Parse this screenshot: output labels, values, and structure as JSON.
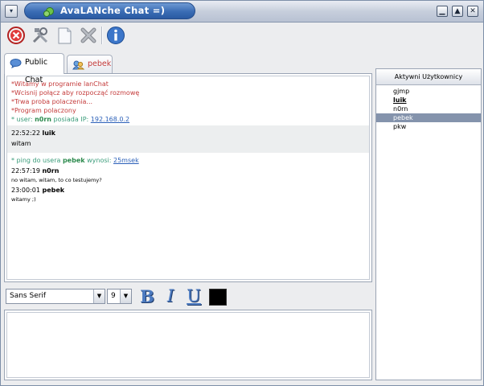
{
  "window": {
    "title": "AvaLANche Chat =)",
    "sysmenu_glyph": "▾",
    "minimize_glyph": "▁",
    "maximize_glyph": "▲",
    "close_glyph": "✕",
    "icon": "app-network-icon"
  },
  "toolbar": {
    "items": [
      {
        "name": "disconnect-icon"
      },
      {
        "name": "settings-tools-icon"
      },
      {
        "name": "clear-page-icon"
      },
      {
        "name": "close-tab-icon"
      },
      {
        "name": "info-icon"
      }
    ]
  },
  "tabs": [
    {
      "label": "Public Chat",
      "active": true,
      "icon": "chat-bubble-icon"
    },
    {
      "label": "pebek",
      "active": false,
      "icon": "user-icon"
    }
  ],
  "chat": {
    "system_lines": [
      "*Witamy w programie lanChat",
      "*Wcisnij połącz aby rozpocząć rozmowę",
      "*Trwa proba polaczenia...",
      "*Program polaczony"
    ],
    "info1": {
      "prefix": "* user: ",
      "user": "n0rn",
      "middle": " posiada IP: ",
      "link": "192.168.0.2"
    },
    "msg1": {
      "time": "22:52:22",
      "user": "luik",
      "text": "witam"
    },
    "info2": {
      "prefix": "* ping do usera ",
      "user": "pebek",
      "middle": " wynosi: ",
      "link": "25msek"
    },
    "msg2": {
      "time": "22:57:19",
      "user": "n0rn",
      "text": "no witam, witam, to co testujemy?"
    },
    "msg3": {
      "time": "23:00:01",
      "user": "pebek",
      "text": "witamy ;)"
    }
  },
  "format": {
    "font_family": "Sans Serif",
    "font_size": "9",
    "bold_label": "B",
    "italic_label": "I",
    "underline_label": "U",
    "arrow_glyph": "▼",
    "color": "#000000"
  },
  "input": {
    "value": ""
  },
  "users": {
    "header": "Aktywni Użytkownicy",
    "list": [
      {
        "name": "gjmp",
        "selected": false,
        "bold": false
      },
      {
        "name": "luik",
        "selected": false,
        "bold": true
      },
      {
        "name": "n0rn",
        "selected": false,
        "bold": false
      },
      {
        "name": "pebek",
        "selected": true,
        "bold": false
      },
      {
        "name": "pkw",
        "selected": false,
        "bold": false
      }
    ]
  },
  "colors": {
    "system_text": "#c43b3b",
    "info_text": "#3a9c7a",
    "title_bar": "#3a6cb4",
    "selection": "#8493ac"
  }
}
